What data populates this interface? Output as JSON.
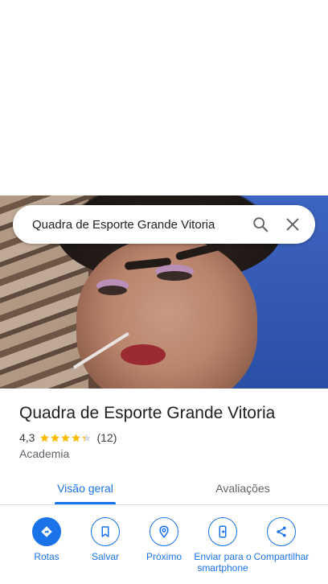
{
  "search": {
    "query": "Quadra de Esporte Grande Vitoria"
  },
  "place": {
    "name": "Quadra de Esporte Grande Vitoria",
    "rating": "4,3",
    "rating_value": 4.3,
    "review_count": "(12)",
    "category": "Academia"
  },
  "tabs": [
    {
      "label": "Visão geral",
      "selected": true
    },
    {
      "label": "Avaliações",
      "selected": false
    }
  ],
  "actions": [
    {
      "label": "Rotas",
      "icon": "directions-icon"
    },
    {
      "label": "Salvar",
      "icon": "bookmark-icon"
    },
    {
      "label": "Próximo",
      "icon": "nearby-icon"
    },
    {
      "label": "Enviar para o smartphone",
      "icon": "send-to-phone-icon"
    },
    {
      "label": "Compartilhar",
      "icon": "share-icon"
    }
  ],
  "colors": {
    "accent": "#1a73e8",
    "star": "#fbbc04"
  }
}
